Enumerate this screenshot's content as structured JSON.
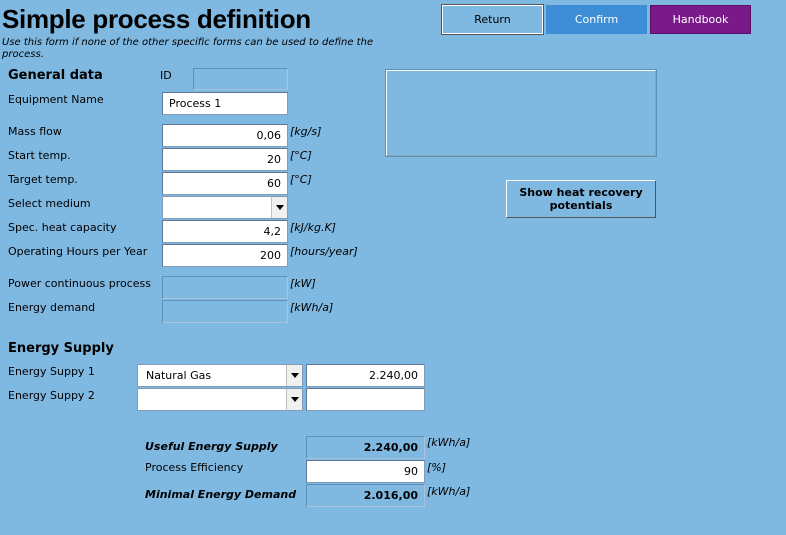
{
  "header": {
    "title": "Simple process definition",
    "subtitle": "Use this form if none of the other specific forms can be used to define the process."
  },
  "buttons": {
    "return": "Return",
    "confirm": "Confirm",
    "handbook": "Handbook",
    "heat_recovery": "Show heat recovery potentials"
  },
  "general": {
    "heading": "General data",
    "id_label": "ID",
    "id_value": "",
    "equipment_label": "Equipment Name",
    "equipment_value": "Process 1",
    "mass_flow_label": "Mass flow",
    "mass_flow_value": "0,06",
    "mass_flow_unit": "[kg/s]",
    "start_temp_label": "Start temp.",
    "start_temp_value": "20",
    "start_temp_unit": "[°C]",
    "target_temp_label": "Target temp.",
    "target_temp_value": "60",
    "target_temp_unit": "[°C]",
    "medium_label": "Select medium",
    "medium_value": "",
    "heat_cap_label": "Spec. heat capacity",
    "heat_cap_value": "4,2",
    "heat_cap_unit": "[kJ/kg.K]",
    "hours_label": "Operating Hours per Year",
    "hours_value": "200",
    "hours_unit": "[hours/year]",
    "power_label": "Power continuous process",
    "power_value": "",
    "power_unit": "[kW]",
    "energy_label": "Energy demand",
    "energy_value": "",
    "energy_unit": "[kWh/a]"
  },
  "supply": {
    "heading": "Energy Supply",
    "supply1_label": "Energy Suppy 1",
    "supply1_value": "Natural Gas",
    "supply1_amount": "2.240,00",
    "supply2_label": "Energy Suppy 2",
    "supply2_value": "",
    "supply2_amount": ""
  },
  "summary": {
    "useful_label": "Useful Energy Supply",
    "useful_value": "2.240,00",
    "useful_unit": "[kWh/a]",
    "efficiency_label": "Process Efficiency",
    "efficiency_value": "90",
    "efficiency_unit": "[%]",
    "minimal_label": "Minimal Energy Demand",
    "minimal_value": "2.016,00",
    "minimal_unit": "[kWh/a]"
  },
  "colors": {
    "background": "#7fb8e0",
    "confirm": "#3d8ed6",
    "handbook": "#7a1a8a"
  }
}
